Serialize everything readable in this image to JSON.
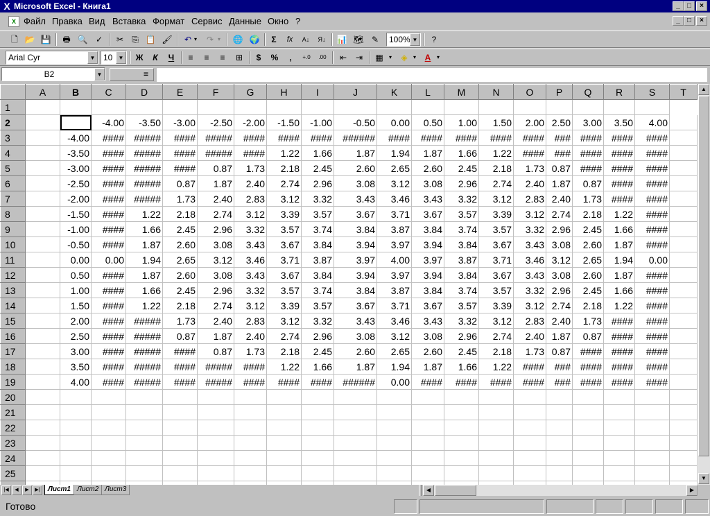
{
  "window": {
    "title": "Microsoft Excel - Книга1"
  },
  "menu": [
    "Файл",
    "Правка",
    "Вид",
    "Вставка",
    "Формат",
    "Сервис",
    "Данные",
    "Окно",
    "?"
  ],
  "toolbar": {
    "zoom": "100%",
    "font": "Arial Cyr",
    "size": "10",
    "bold": "Ж",
    "italic": "К",
    "underline": "Ч"
  },
  "formula": {
    "cell_ref": "B2",
    "equals": "="
  },
  "columns": [
    "A",
    "B",
    "C",
    "D",
    "E",
    "F",
    "G",
    "H",
    "I",
    "J",
    "K",
    "L",
    "M",
    "N",
    "O",
    "P",
    "Q",
    "R",
    "S",
    "T"
  ],
  "column_widths": [
    50,
    45,
    50,
    53,
    50,
    53,
    47,
    50,
    47,
    62,
    50,
    47,
    50,
    50,
    47,
    38,
    45,
    45,
    50,
    40
  ],
  "rows": [
    [
      "1",
      "",
      "",
      "",
      "",
      "",
      "",
      "",
      "",
      "",
      "",
      "",
      "",
      "",
      "",
      "",
      "",
      "",
      "",
      ""
    ],
    [
      "2",
      "",
      "",
      "-4.00",
      "-3.50",
      "-3.00",
      "-2.50",
      "-2.00",
      "-1.50",
      "-1.00",
      "-0.50",
      "0.00",
      "0.50",
      "1.00",
      "1.50",
      "2.00",
      "2.50",
      "3.00",
      "3.50",
      "4.00",
      ""
    ],
    [
      "3",
      "",
      "-4.00",
      "####",
      "#####",
      "####",
      "#####",
      "####",
      "####",
      "####",
      "######",
      "####",
      "####",
      "####",
      "####",
      "####",
      "###",
      "####",
      "####",
      "####",
      ""
    ],
    [
      "4",
      "",
      "-3.50",
      "####",
      "#####",
      "####",
      "#####",
      "####",
      "1.22",
      "1.66",
      "1.87",
      "1.94",
      "1.87",
      "1.66",
      "1.22",
      "####",
      "###",
      "####",
      "####",
      "####",
      ""
    ],
    [
      "5",
      "",
      "-3.00",
      "####",
      "#####",
      "####",
      "0.87",
      "1.73",
      "2.18",
      "2.45",
      "2.60",
      "2.65",
      "2.60",
      "2.45",
      "2.18",
      "1.73",
      "0.87",
      "####",
      "####",
      "####",
      ""
    ],
    [
      "6",
      "",
      "-2.50",
      "####",
      "#####",
      "0.87",
      "1.87",
      "2.40",
      "2.74",
      "2.96",
      "3.08",
      "3.12",
      "3.08",
      "2.96",
      "2.74",
      "2.40",
      "1.87",
      "0.87",
      "####",
      "####",
      ""
    ],
    [
      "7",
      "",
      "-2.00",
      "####",
      "#####",
      "1.73",
      "2.40",
      "2.83",
      "3.12",
      "3.32",
      "3.43",
      "3.46",
      "3.43",
      "3.32",
      "3.12",
      "2.83",
      "2.40",
      "1.73",
      "####",
      "####",
      ""
    ],
    [
      "8",
      "",
      "-1.50",
      "####",
      "1.22",
      "2.18",
      "2.74",
      "3.12",
      "3.39",
      "3.57",
      "3.67",
      "3.71",
      "3.67",
      "3.57",
      "3.39",
      "3.12",
      "2.74",
      "2.18",
      "1.22",
      "####",
      ""
    ],
    [
      "9",
      "",
      "-1.00",
      "####",
      "1.66",
      "2.45",
      "2.96",
      "3.32",
      "3.57",
      "3.74",
      "3.84",
      "3.87",
      "3.84",
      "3.74",
      "3.57",
      "3.32",
      "2.96",
      "2.45",
      "1.66",
      "####",
      ""
    ],
    [
      "10",
      "",
      "-0.50",
      "####",
      "1.87",
      "2.60",
      "3.08",
      "3.43",
      "3.67",
      "3.84",
      "3.94",
      "3.97",
      "3.94",
      "3.84",
      "3.67",
      "3.43",
      "3.08",
      "2.60",
      "1.87",
      "####",
      ""
    ],
    [
      "11",
      "",
      "0.00",
      "0.00",
      "1.94",
      "2.65",
      "3.12",
      "3.46",
      "3.71",
      "3.87",
      "3.97",
      "4.00",
      "3.97",
      "3.87",
      "3.71",
      "3.46",
      "3.12",
      "2.65",
      "1.94",
      "0.00",
      ""
    ],
    [
      "12",
      "",
      "0.50",
      "####",
      "1.87",
      "2.60",
      "3.08",
      "3.43",
      "3.67",
      "3.84",
      "3.94",
      "3.97",
      "3.94",
      "3.84",
      "3.67",
      "3.43",
      "3.08",
      "2.60",
      "1.87",
      "####",
      ""
    ],
    [
      "13",
      "",
      "1.00",
      "####",
      "1.66",
      "2.45",
      "2.96",
      "3.32",
      "3.57",
      "3.74",
      "3.84",
      "3.87",
      "3.84",
      "3.74",
      "3.57",
      "3.32",
      "2.96",
      "2.45",
      "1.66",
      "####",
      ""
    ],
    [
      "14",
      "",
      "1.50",
      "####",
      "1.22",
      "2.18",
      "2.74",
      "3.12",
      "3.39",
      "3.57",
      "3.67",
      "3.71",
      "3.67",
      "3.57",
      "3.39",
      "3.12",
      "2.74",
      "2.18",
      "1.22",
      "####",
      ""
    ],
    [
      "15",
      "",
      "2.00",
      "####",
      "#####",
      "1.73",
      "2.40",
      "2.83",
      "3.12",
      "3.32",
      "3.43",
      "3.46",
      "3.43",
      "3.32",
      "3.12",
      "2.83",
      "2.40",
      "1.73",
      "####",
      "####",
      ""
    ],
    [
      "16",
      "",
      "2.50",
      "####",
      "#####",
      "0.87",
      "1.87",
      "2.40",
      "2.74",
      "2.96",
      "3.08",
      "3.12",
      "3.08",
      "2.96",
      "2.74",
      "2.40",
      "1.87",
      "0.87",
      "####",
      "####",
      ""
    ],
    [
      "17",
      "",
      "3.00",
      "####",
      "#####",
      "####",
      "0.87",
      "1.73",
      "2.18",
      "2.45",
      "2.60",
      "2.65",
      "2.60",
      "2.45",
      "2.18",
      "1.73",
      "0.87",
      "####",
      "####",
      "####",
      ""
    ],
    [
      "18",
      "",
      "3.50",
      "####",
      "#####",
      "####",
      "#####",
      "####",
      "1.22",
      "1.66",
      "1.87",
      "1.94",
      "1.87",
      "1.66",
      "1.22",
      "####",
      "###",
      "####",
      "####",
      "####",
      ""
    ],
    [
      "19",
      "",
      "4.00",
      "####",
      "#####",
      "####",
      "#####",
      "####",
      "####",
      "####",
      "######",
      "0.00",
      "####",
      "####",
      "####",
      "####",
      "###",
      "####",
      "####",
      "####",
      ""
    ],
    [
      "20",
      "",
      "",
      "",
      "",
      "",
      "",
      "",
      "",
      "",
      "",
      "",
      "",
      "",
      "",
      "",
      "",
      "",
      "",
      "",
      ""
    ],
    [
      "21",
      "",
      "",
      "",
      "",
      "",
      "",
      "",
      "",
      "",
      "",
      "",
      "",
      "",
      "",
      "",
      "",
      "",
      "",
      "",
      ""
    ],
    [
      "22",
      "",
      "",
      "",
      "",
      "",
      "",
      "",
      "",
      "",
      "",
      "",
      "",
      "",
      "",
      "",
      "",
      "",
      "",
      "",
      ""
    ],
    [
      "23",
      "",
      "",
      "",
      "",
      "",
      "",
      "",
      "",
      "",
      "",
      "",
      "",
      "",
      "",
      "",
      "",
      "",
      "",
      "",
      ""
    ],
    [
      "24",
      "",
      "",
      "",
      "",
      "",
      "",
      "",
      "",
      "",
      "",
      "",
      "",
      "",
      "",
      "",
      "",
      "",
      "",
      "",
      ""
    ],
    [
      "25",
      "",
      "",
      "",
      "",
      "",
      "",
      "",
      "",
      "",
      "",
      "",
      "",
      "",
      "",
      "",
      "",
      "",
      "",
      "",
      ""
    ],
    [
      "26",
      "",
      "",
      "",
      "",
      "",
      "",
      "",
      "",
      "",
      "",
      "",
      "",
      "",
      "",
      "",
      "",
      "",
      "",
      "",
      ""
    ]
  ],
  "sheets": [
    "Лист1",
    "Лист2",
    "Лист3"
  ],
  "status": "Готово",
  "colors": {
    "title_bg": "#000080",
    "chrome": "#c0c0c0"
  }
}
